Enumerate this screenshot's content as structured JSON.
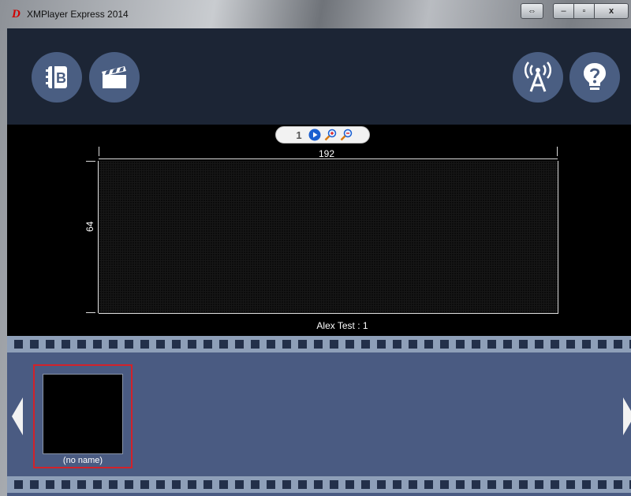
{
  "window": {
    "title": "XMPlayer Express 2014",
    "logo_letter": "D",
    "buttons": {
      "swap": "⇔",
      "minimize": "–",
      "maximize": "▫",
      "close": "x"
    }
  },
  "toolbar": {
    "left_buttons": [
      "contacts-book-icon",
      "clapperboard-icon"
    ],
    "right_buttons": [
      "broadcast-tower-icon",
      "help-icon"
    ]
  },
  "display": {
    "mini_toolbar": {
      "one_to_one_label": "1"
    },
    "width_label": "192",
    "height_label": "64",
    "caption": "Alex Test : 1"
  },
  "filmstrip": {
    "items": [
      {
        "label": "(no name)"
      }
    ]
  },
  "colors": {
    "accent": "#4a5e82",
    "selection": "#d2222a",
    "toolbar_bg": "#1c2535",
    "filmstrip_bg": "#4a5b82"
  }
}
